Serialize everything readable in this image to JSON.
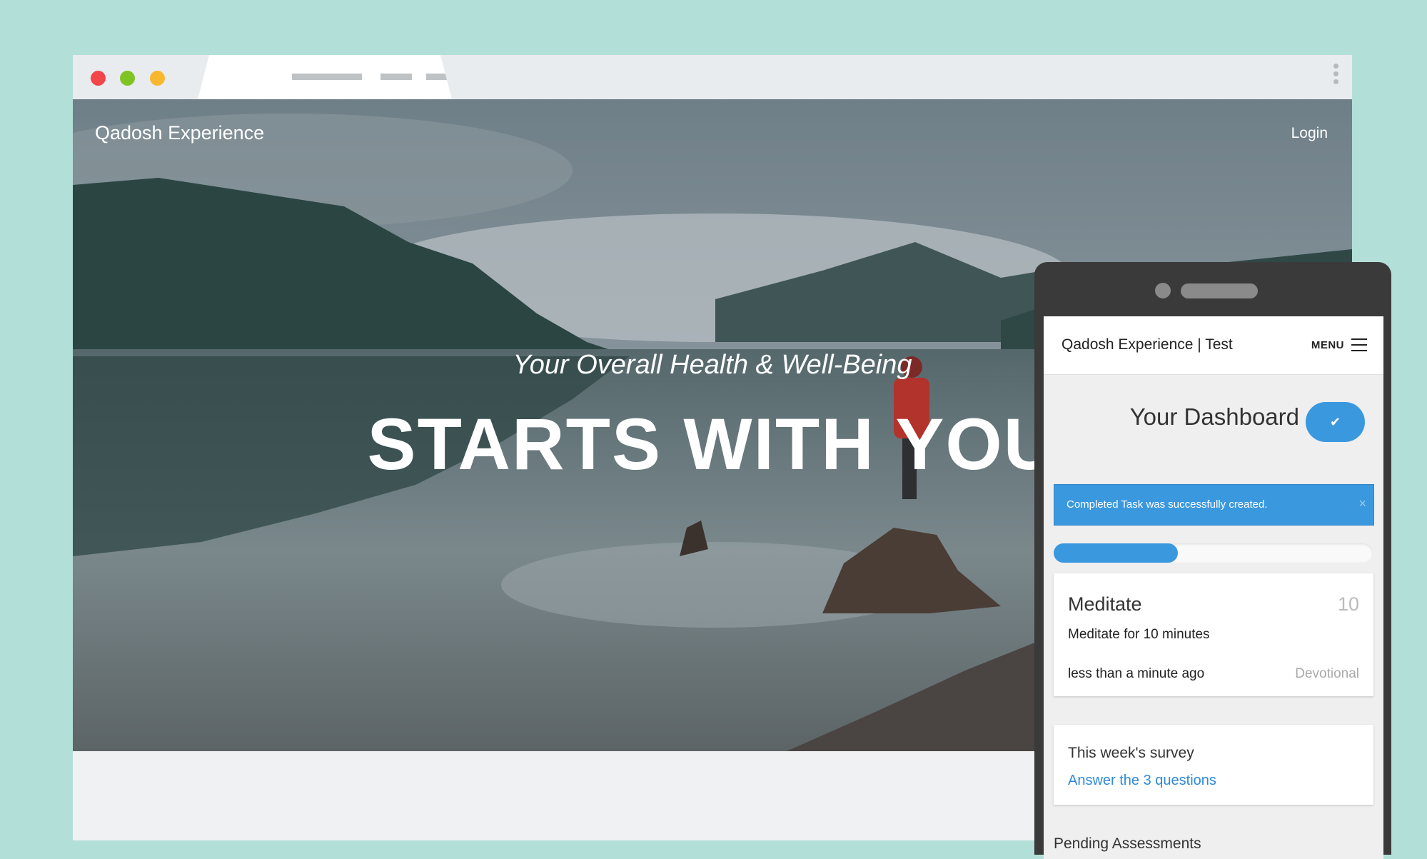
{
  "browser": {
    "window_controls": [
      "close",
      "minimize",
      "maximize"
    ],
    "menu_icon": "kebab-icon"
  },
  "site": {
    "brand": "Qadosh Experience",
    "login": "Login",
    "tagline": "Your Overall Health & Well-Being",
    "headline": "STARTS WITH YOU"
  },
  "phone": {
    "header": {
      "title": "Qadosh Experience | Test",
      "menu_label": "MENU"
    },
    "dashboard_title": "Your Dashboard",
    "check_button_icon": "✔",
    "alert": {
      "text": "Completed Task was successfully created.",
      "close": "×"
    },
    "progress_fraction": 0.39,
    "task": {
      "title": "Meditate",
      "points": "10",
      "description": "Meditate for 10 minutes",
      "time": "less than a minute ago",
      "category": "Devotional"
    },
    "survey": {
      "title": "This week's survey",
      "link": "Answer the 3 questions"
    },
    "pending_heading": "Pending Assessments"
  },
  "colors": {
    "background": "#b3dfd9",
    "accent_blue": "#3a98df",
    "phone_body": "#3a3a3a"
  }
}
